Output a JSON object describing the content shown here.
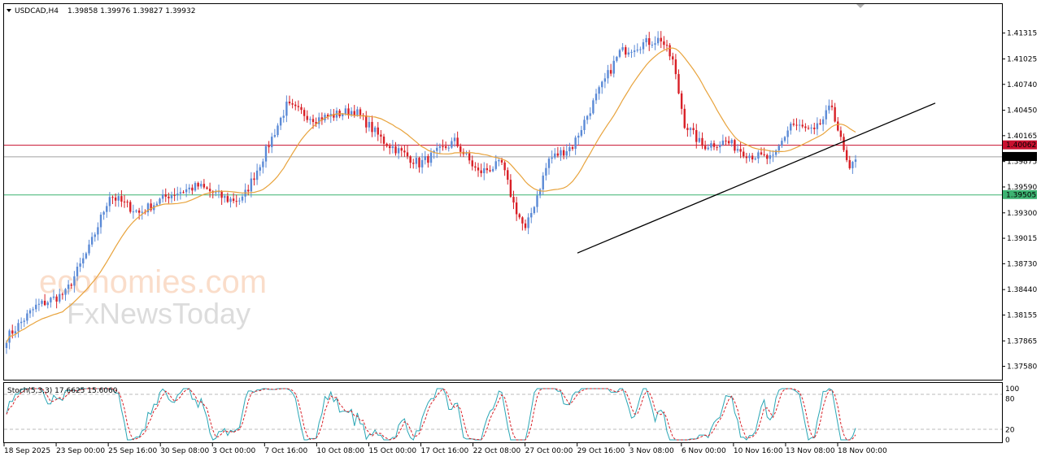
{
  "chart_data": {
    "type": "candlestick",
    "symbol": "USDCAD,H4",
    "ohlc_header": "1.39858 1.39976 1.39827 1.39932",
    "ylim": [
      1.3743,
      1.4164
    ],
    "price_ticks": [
      "1.41315",
      "1.41025",
      "1.40740",
      "1.40450",
      "1.40165",
      "1.39875",
      "1.39590",
      "1.39300",
      "1.39015",
      "1.38730",
      "1.38440",
      "1.38155",
      "1.37865",
      "1.37580"
    ],
    "x_ticks": [
      "18 Sep 2025",
      "23 Sep 00:00",
      "25 Sep 16:00",
      "30 Sep 08:00",
      "3 Oct 00:00",
      "7 Oct 16:00",
      "10 Oct 08:00",
      "15 Oct 00:00",
      "17 Oct 16:00",
      "22 Oct 08:00",
      "27 Oct 00:00",
      "29 Oct 16:00",
      "3 Nov 08:00",
      "6 Nov 00:00",
      "10 Nov 16:00",
      "13 Nov 08:00",
      "18 Nov 00:00"
    ],
    "anchors": [
      [
        0,
        1.379
      ],
      [
        10,
        1.3825
      ],
      [
        20,
        1.384
      ],
      [
        28,
        1.389
      ],
      [
        35,
        1.395
      ],
      [
        45,
        1.393
      ],
      [
        55,
        1.395
      ],
      [
        65,
        1.396
      ],
      [
        75,
        1.3945
      ],
      [
        80,
        1.3945
      ],
      [
        86,
        1.3985
      ],
      [
        95,
        1.405
      ],
      [
        105,
        1.4035
      ],
      [
        118,
        1.4045
      ],
      [
        128,
        1.401
      ],
      [
        140,
        1.3985
      ],
      [
        152,
        1.401
      ],
      [
        160,
        1.3975
      ],
      [
        168,
        1.3985
      ],
      [
        172,
        1.394
      ],
      [
        176,
        1.391
      ],
      [
        180,
        1.395
      ],
      [
        184,
        1.399
      ],
      [
        192,
        1.4005
      ],
      [
        200,
        1.406
      ],
      [
        208,
        1.411
      ],
      [
        216,
        1.412
      ],
      [
        222,
        1.4125
      ],
      [
        226,
        1.41
      ],
      [
        230,
        1.403
      ],
      [
        236,
        1.4005
      ],
      [
        244,
        1.401
      ],
      [
        252,
        1.3995
      ],
      [
        260,
        1.399
      ],
      [
        266,
        1.403
      ],
      [
        274,
        1.402
      ],
      [
        280,
        1.405
      ],
      [
        284,
        1.3998
      ],
      [
        286,
        1.3975
      ],
      [
        288,
        1.3993
      ]
    ],
    "last_price": "1.39932",
    "last_price_value": 1.39932,
    "resistance": {
      "label": "1.40062",
      "value": 1.40062,
      "color": "#c8102e"
    },
    "support": {
      "label": "1.39505",
      "value": 1.39505,
      "color": "#3cb371"
    },
    "grey_line": {
      "value": 1.39932,
      "color": "#a0a0a0"
    },
    "trendline": {
      "from": [
        1.3885
      ],
      "to": [
        1.4053
      ],
      "color": "#000000"
    },
    "moving_average": {
      "color": "#e8a33c"
    },
    "bull_color": "#5b8ad6",
    "bear_color": "#d81f26",
    "stochastic": {
      "label": "Stoch(5,3,3) 17.6625 15.6060",
      "levels": [
        "100",
        "80",
        "20",
        "0"
      ],
      "main_color": "#2aa6b5",
      "signal_color": "#d81f26"
    },
    "watermark": {
      "line1": "economies.com",
      "line2": "FxNewsToday"
    }
  }
}
